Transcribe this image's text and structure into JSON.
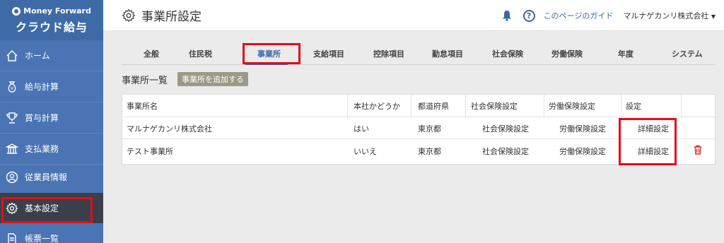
{
  "brand": {
    "top": "Money Forward",
    "bottom": "クラウド給与"
  },
  "sidebar": {
    "items": [
      {
        "label": "ホーム",
        "icon": "home-icon"
      },
      {
        "label": "給与計算",
        "icon": "money-bag-icon"
      },
      {
        "label": "賞与計算",
        "icon": "trophy-icon"
      },
      {
        "label": "支払業務",
        "icon": "bank-icon"
      },
      {
        "label": "従業員情報",
        "icon": "employee-icon"
      },
      {
        "label": "基本設定",
        "icon": "gear-icon"
      },
      {
        "label": "帳票一覧",
        "icon": "document-icon"
      }
    ],
    "active_index": 5
  },
  "header": {
    "title": "事業所設定",
    "guide_link": "このページのガイド",
    "company": "マルナゲカンリ株式会社"
  },
  "tabs": [
    "全般",
    "住民税",
    "事業所",
    "支給項目",
    "控除項目",
    "勤怠項目",
    "社会保険",
    "労働保険",
    "年度",
    "システム"
  ],
  "active_tab": 2,
  "section": {
    "title": "事業所一覧",
    "add_button": "事業所を追加する"
  },
  "table": {
    "headers": [
      "事業所名",
      "本社かどうか",
      "都道府県",
      "社会保険設定",
      "労働保険設定",
      "設定"
    ],
    "rows": [
      {
        "name": "マルナゲカンリ株式会社",
        "hq": "はい",
        "pref": "東京都",
        "social": "社会保険設定",
        "labor": "労働保険設定",
        "detail": "詳細設定"
      },
      {
        "name": "テスト事業所",
        "hq": "いいえ",
        "pref": "東京都",
        "social": "社会保険設定",
        "labor": "労働保険設定",
        "detail": "詳細設定"
      }
    ]
  },
  "colors": {
    "sidebar": "#4a74b4",
    "accent": "#3a67a9",
    "highlight": "#e10e17",
    "delete": "#d9322b"
  }
}
